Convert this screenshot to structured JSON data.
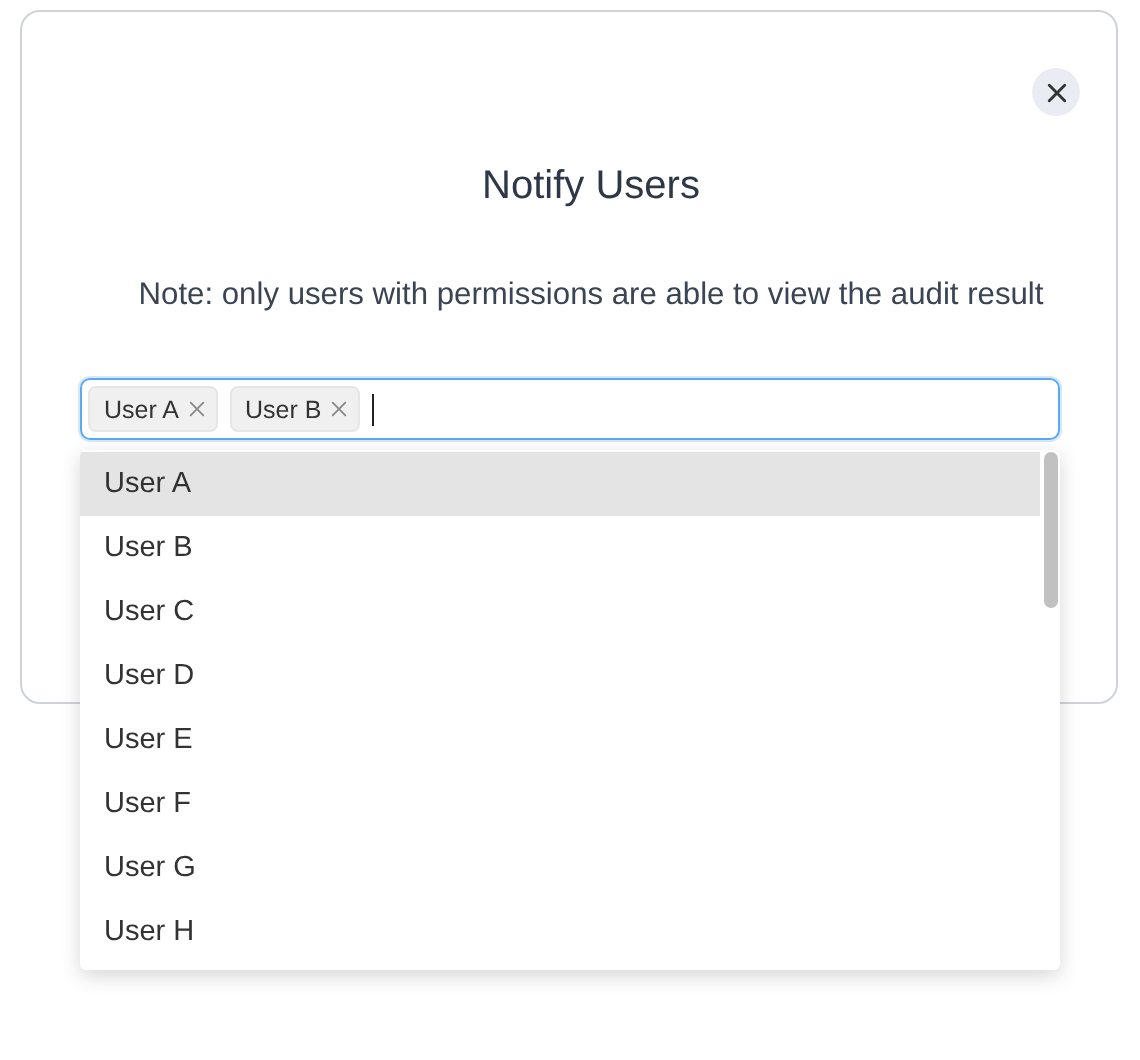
{
  "dialog": {
    "title": "Notify Users",
    "note": "Note: only users with permissions are able to view the audit result"
  },
  "user_field": {
    "focused": true,
    "tags": [
      {
        "label": "User A"
      },
      {
        "label": "User B"
      }
    ]
  },
  "dropdown": {
    "options": [
      {
        "label": "User A",
        "highlighted": true
      },
      {
        "label": "User B",
        "highlighted": false
      },
      {
        "label": "User C",
        "highlighted": false
      },
      {
        "label": "User D",
        "highlighted": false
      },
      {
        "label": "User E",
        "highlighted": false
      },
      {
        "label": "User F",
        "highlighted": false
      },
      {
        "label": "User G",
        "highlighted": false
      },
      {
        "label": "User H",
        "highlighted": false
      }
    ]
  }
}
